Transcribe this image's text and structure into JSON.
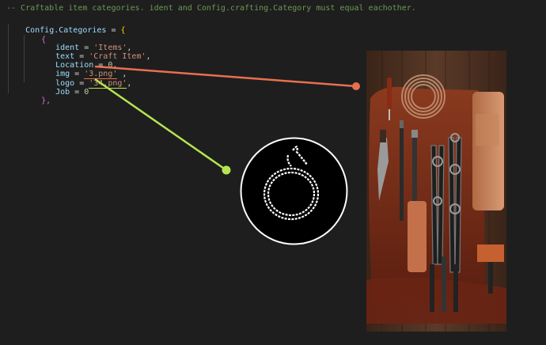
{
  "editor": {
    "comment": "-- Craftable item categories. ident and Config.crafting.Category must equal eachother.",
    "config_obj": "Config",
    "dot": ".",
    "categories_key": "Categories",
    "assign": " = ",
    "open_brace": "{",
    "inner_open": "{",
    "fields": [
      {
        "key": "ident",
        "eq": " = ",
        "value": "'Items'",
        "suffix": ","
      },
      {
        "key": "text",
        "eq": " = ",
        "value": "'Craft Item'",
        "suffix": ","
      },
      {
        "key": "Location",
        "eq": " = ",
        "value": "0",
        "suffix": ","
      },
      {
        "key": "img",
        "eq": " = ",
        "value": "'3.png'",
        "suffix": " ,"
      },
      {
        "key": "logo",
        "eq": " = ",
        "value": "'34.png'",
        "suffix": ","
      },
      {
        "key": "Job",
        "eq": " = ",
        "value": "0",
        "suffix": ""
      }
    ],
    "inner_close": "},"
  },
  "annotations": {
    "img_arrow_color": "#e8704f",
    "logo_arrow_color": "#b5e550",
    "img_preview": "craft-tools-image",
    "logo_preview": "rope-logo-image"
  },
  "theme": {
    "background": "#1e1e1e",
    "comment": "#6a9955",
    "identifier": "#9cdcfe",
    "string": "#ce9178",
    "number": "#b5cea8"
  }
}
